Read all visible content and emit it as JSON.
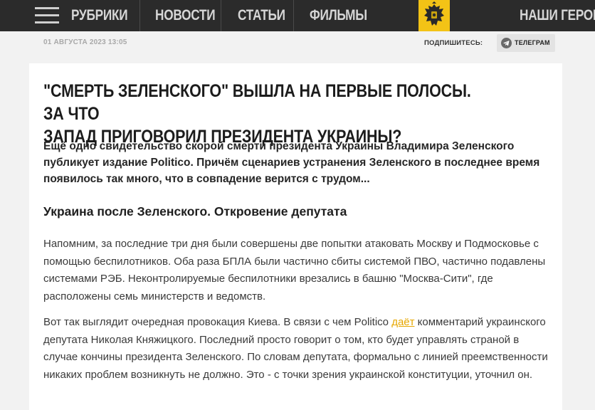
{
  "nav": {
    "items": [
      "РУБРИКИ",
      "НОВОСТИ",
      "СТАТЬИ",
      "ФИЛЬМЫ",
      "НАШИ ГЕРОИ"
    ],
    "emblem_icon": "double-headed-eagle-icon",
    "menu_icon": "hamburger-menu-icon"
  },
  "meta": {
    "date": "01 АВГУСТА 2023 13:05",
    "subscribe_label": "ПОДПИШИТЕСЬ:",
    "telegram_label": "ТЕЛЕГРАМ",
    "telegram_icon": "telegram-paper-plane-icon"
  },
  "article": {
    "title_line1": "\"СМЕРТЬ ЗЕЛЕНСКОГО\" ВЫШЛА НА ПЕРВЫЕ ПОЛОСЫ. ЗА ЧТО",
    "title_line2": "ЗАПАД ПРИГОВОРИЛ ПРЕЗИДЕНТА УКРАИНЫ?",
    "lead": "Ещё одно свидетельство скорой смерти президента Украины Владимира Зеленского публикует издание Politico. Причём сценариев устранения Зеленского в последнее время появилось так много, что в совпадение верится с трудом...",
    "subheading": "Украина после Зеленского. Откровение депутата",
    "paragraph1": "Напомним, за последние три дня были совершены две попытки атаковать Москву и Подмосковье с помощью беспилотников. Оба раза БПЛА были частично сбиты системой ПВО, частично подавлены системами РЭБ. Неконтролируемые беспилотники врезались в башню \"Москва-Сити\", где расположены семь министерств и ведомств.",
    "paragraph2_before": "Вот так выглядит очередная провокация Киева. В связи с чем Politico ",
    "paragraph2_link": "даёт",
    "paragraph2_after": " комментарий украинского депутата Николая Княжицкого. Последний просто говорит о том, кто будет управлять страной в случае кончины президента Зеленского. По словам депутата, формально с линией преемственности никаких проблем возникнуть не должно. Это - с точки зрения украинской конституции, уточнил он."
  },
  "colors": {
    "topbar": "#2b2b2b",
    "emblem_bg": "#f3c316",
    "link": "#e6a700",
    "page_bg": "#f2f2f2"
  }
}
